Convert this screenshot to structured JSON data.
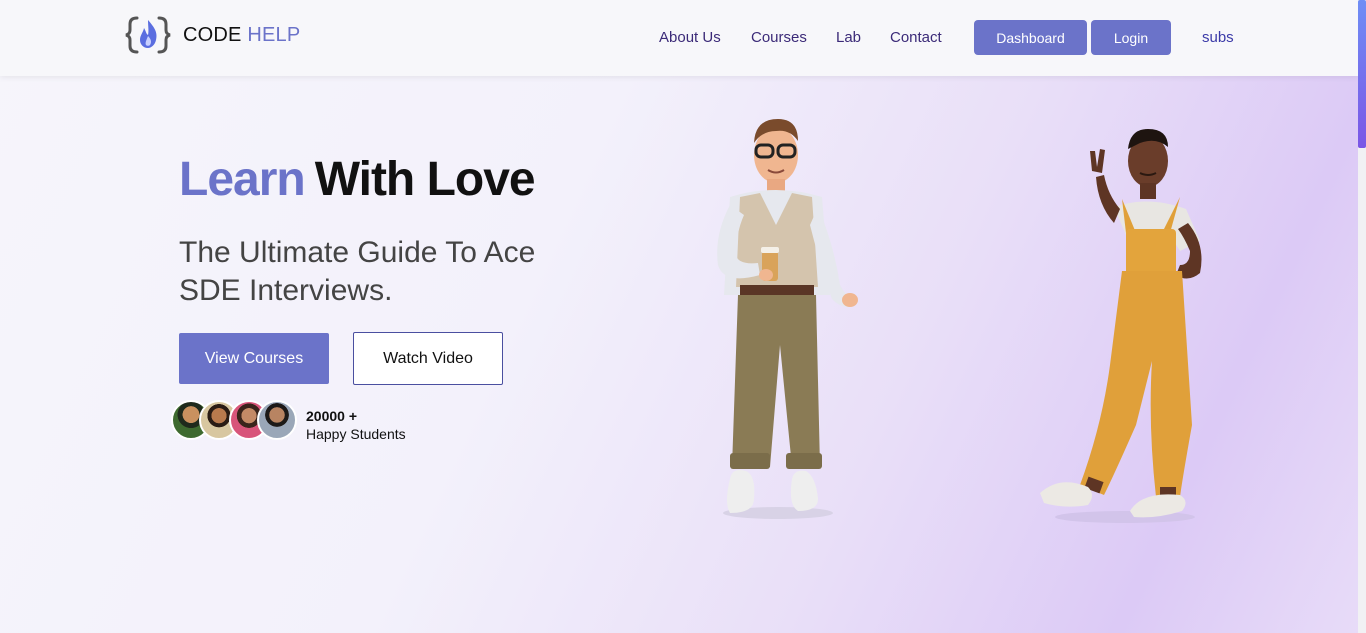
{
  "brand": {
    "name_part1": "CODE",
    "name_part2": "HELP",
    "accent": "#6b73c9"
  },
  "nav": {
    "links": [
      "About Us",
      "Courses",
      "Lab",
      "Contact"
    ],
    "dashboard": "Dashboard",
    "login": "Login",
    "subs": "subs"
  },
  "hero": {
    "title_accent": "Learn",
    "title_rest": "With Love",
    "subtitle": "The Ultimate Guide To Ace SDE Interviews.",
    "primary_cta": "View Courses",
    "secondary_cta": "Watch Video",
    "students_count": "20000 +",
    "students_label": "Happy Students"
  },
  "icons": [
    "code-bracket-flame-icon",
    "student-avatar-icon"
  ],
  "colors": {
    "accent": "#6b73c9",
    "nav_text": "#3b2a78",
    "button_text": "#ffffff"
  }
}
